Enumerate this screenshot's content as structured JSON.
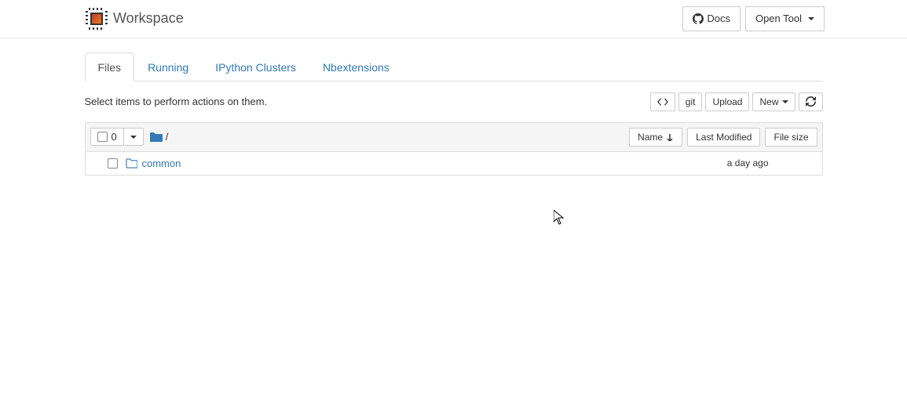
{
  "header": {
    "brand": "Workspace",
    "docs_label": "Docs",
    "open_tool_label": "Open Tool"
  },
  "tabs": [
    {
      "label": "Files",
      "active": true
    },
    {
      "label": "Running",
      "active": false
    },
    {
      "label": "IPython Clusters",
      "active": false
    },
    {
      "label": "Nbextensions",
      "active": false
    }
  ],
  "select_hint": "Select items to perform actions on them.",
  "toolbar": {
    "git_label": "git",
    "upload_label": "Upload",
    "new_label": "New"
  },
  "file_header": {
    "selected_count": "0",
    "breadcrumb_sep": "/",
    "col_name": "Name",
    "col_modified": "Last Modified",
    "col_size": "File size"
  },
  "files": [
    {
      "name": "common",
      "type": "folder",
      "modified": "a day ago",
      "size": ""
    }
  ]
}
